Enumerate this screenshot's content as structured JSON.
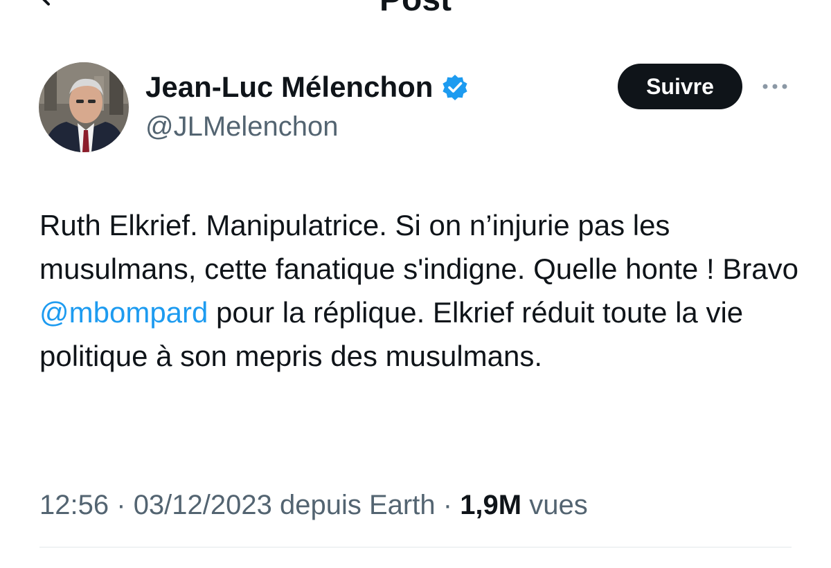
{
  "header": {
    "title": "Post"
  },
  "author": {
    "name": "Jean-Luc Mélenchon",
    "handle": "@JLMelenchon",
    "verified": true,
    "verified_color": "#1d9bf0"
  },
  "actions": {
    "follow_label": "Suivre",
    "more_icon": "more-horizontal-icon"
  },
  "tweet": {
    "text_part1": "Ruth Elkrief. Manipulatrice. Si on n’injurie pas les musulmans, cette fanatique s'indigne. Quelle honte ! Bravo ",
    "mention": "@mbompard",
    "text_part2": " pour la réplique. Elkrief réduit toute la vie politique à son mepris des musulmans."
  },
  "meta": {
    "time": "12:56",
    "separator": "·",
    "date": "03/12/2023",
    "source": "depuis Earth",
    "views_count": "1,9M",
    "views_label": "vues"
  },
  "colors": {
    "accent": "#1d9bf0",
    "text_primary": "#0f1419",
    "text_secondary": "#536471",
    "button_bg": "#0f1419"
  }
}
